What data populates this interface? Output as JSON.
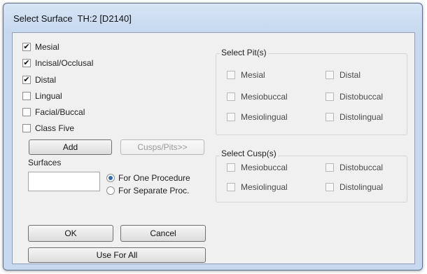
{
  "window": {
    "title": "Select Surface  TH:2 [D2140]"
  },
  "surfaces_list": [
    {
      "label": "Mesial",
      "checked": true
    },
    {
      "label": "Incisal/Occlusal",
      "checked": true
    },
    {
      "label": "Distal",
      "checked": true
    },
    {
      "label": "Lingual",
      "checked": false
    },
    {
      "label": "Facial/Buccal",
      "checked": false
    },
    {
      "label": "Class Five",
      "checked": false
    }
  ],
  "buttons": {
    "add": "Add",
    "cusps_pits": "Cusps/Pits>>",
    "ok": "OK",
    "cancel": "Cancel",
    "use_for_all": "Use For All"
  },
  "surfaces_field": {
    "label": "Surfaces",
    "value": ""
  },
  "procedure_options": [
    {
      "label": "For One Procedure",
      "selected": true
    },
    {
      "label": "For Separate Proc.",
      "selected": false
    }
  ],
  "pits_group": {
    "title": "Select Pit(s)",
    "items": [
      "Mesial",
      "Distal",
      "Mesiobuccal",
      "Distobuccal",
      "Mesiolingual",
      "Distolingual"
    ]
  },
  "cusps_group": {
    "title": "Select Cusp(s)",
    "items": [
      "Mesiobuccal",
      "Distobuccal",
      "Mesiolingual",
      "Distolingual"
    ]
  },
  "colors": {
    "title_bar": "#c6d9ef",
    "dialog_bg": "#f0f0f0",
    "radio_dot": "#2c6bc0"
  }
}
